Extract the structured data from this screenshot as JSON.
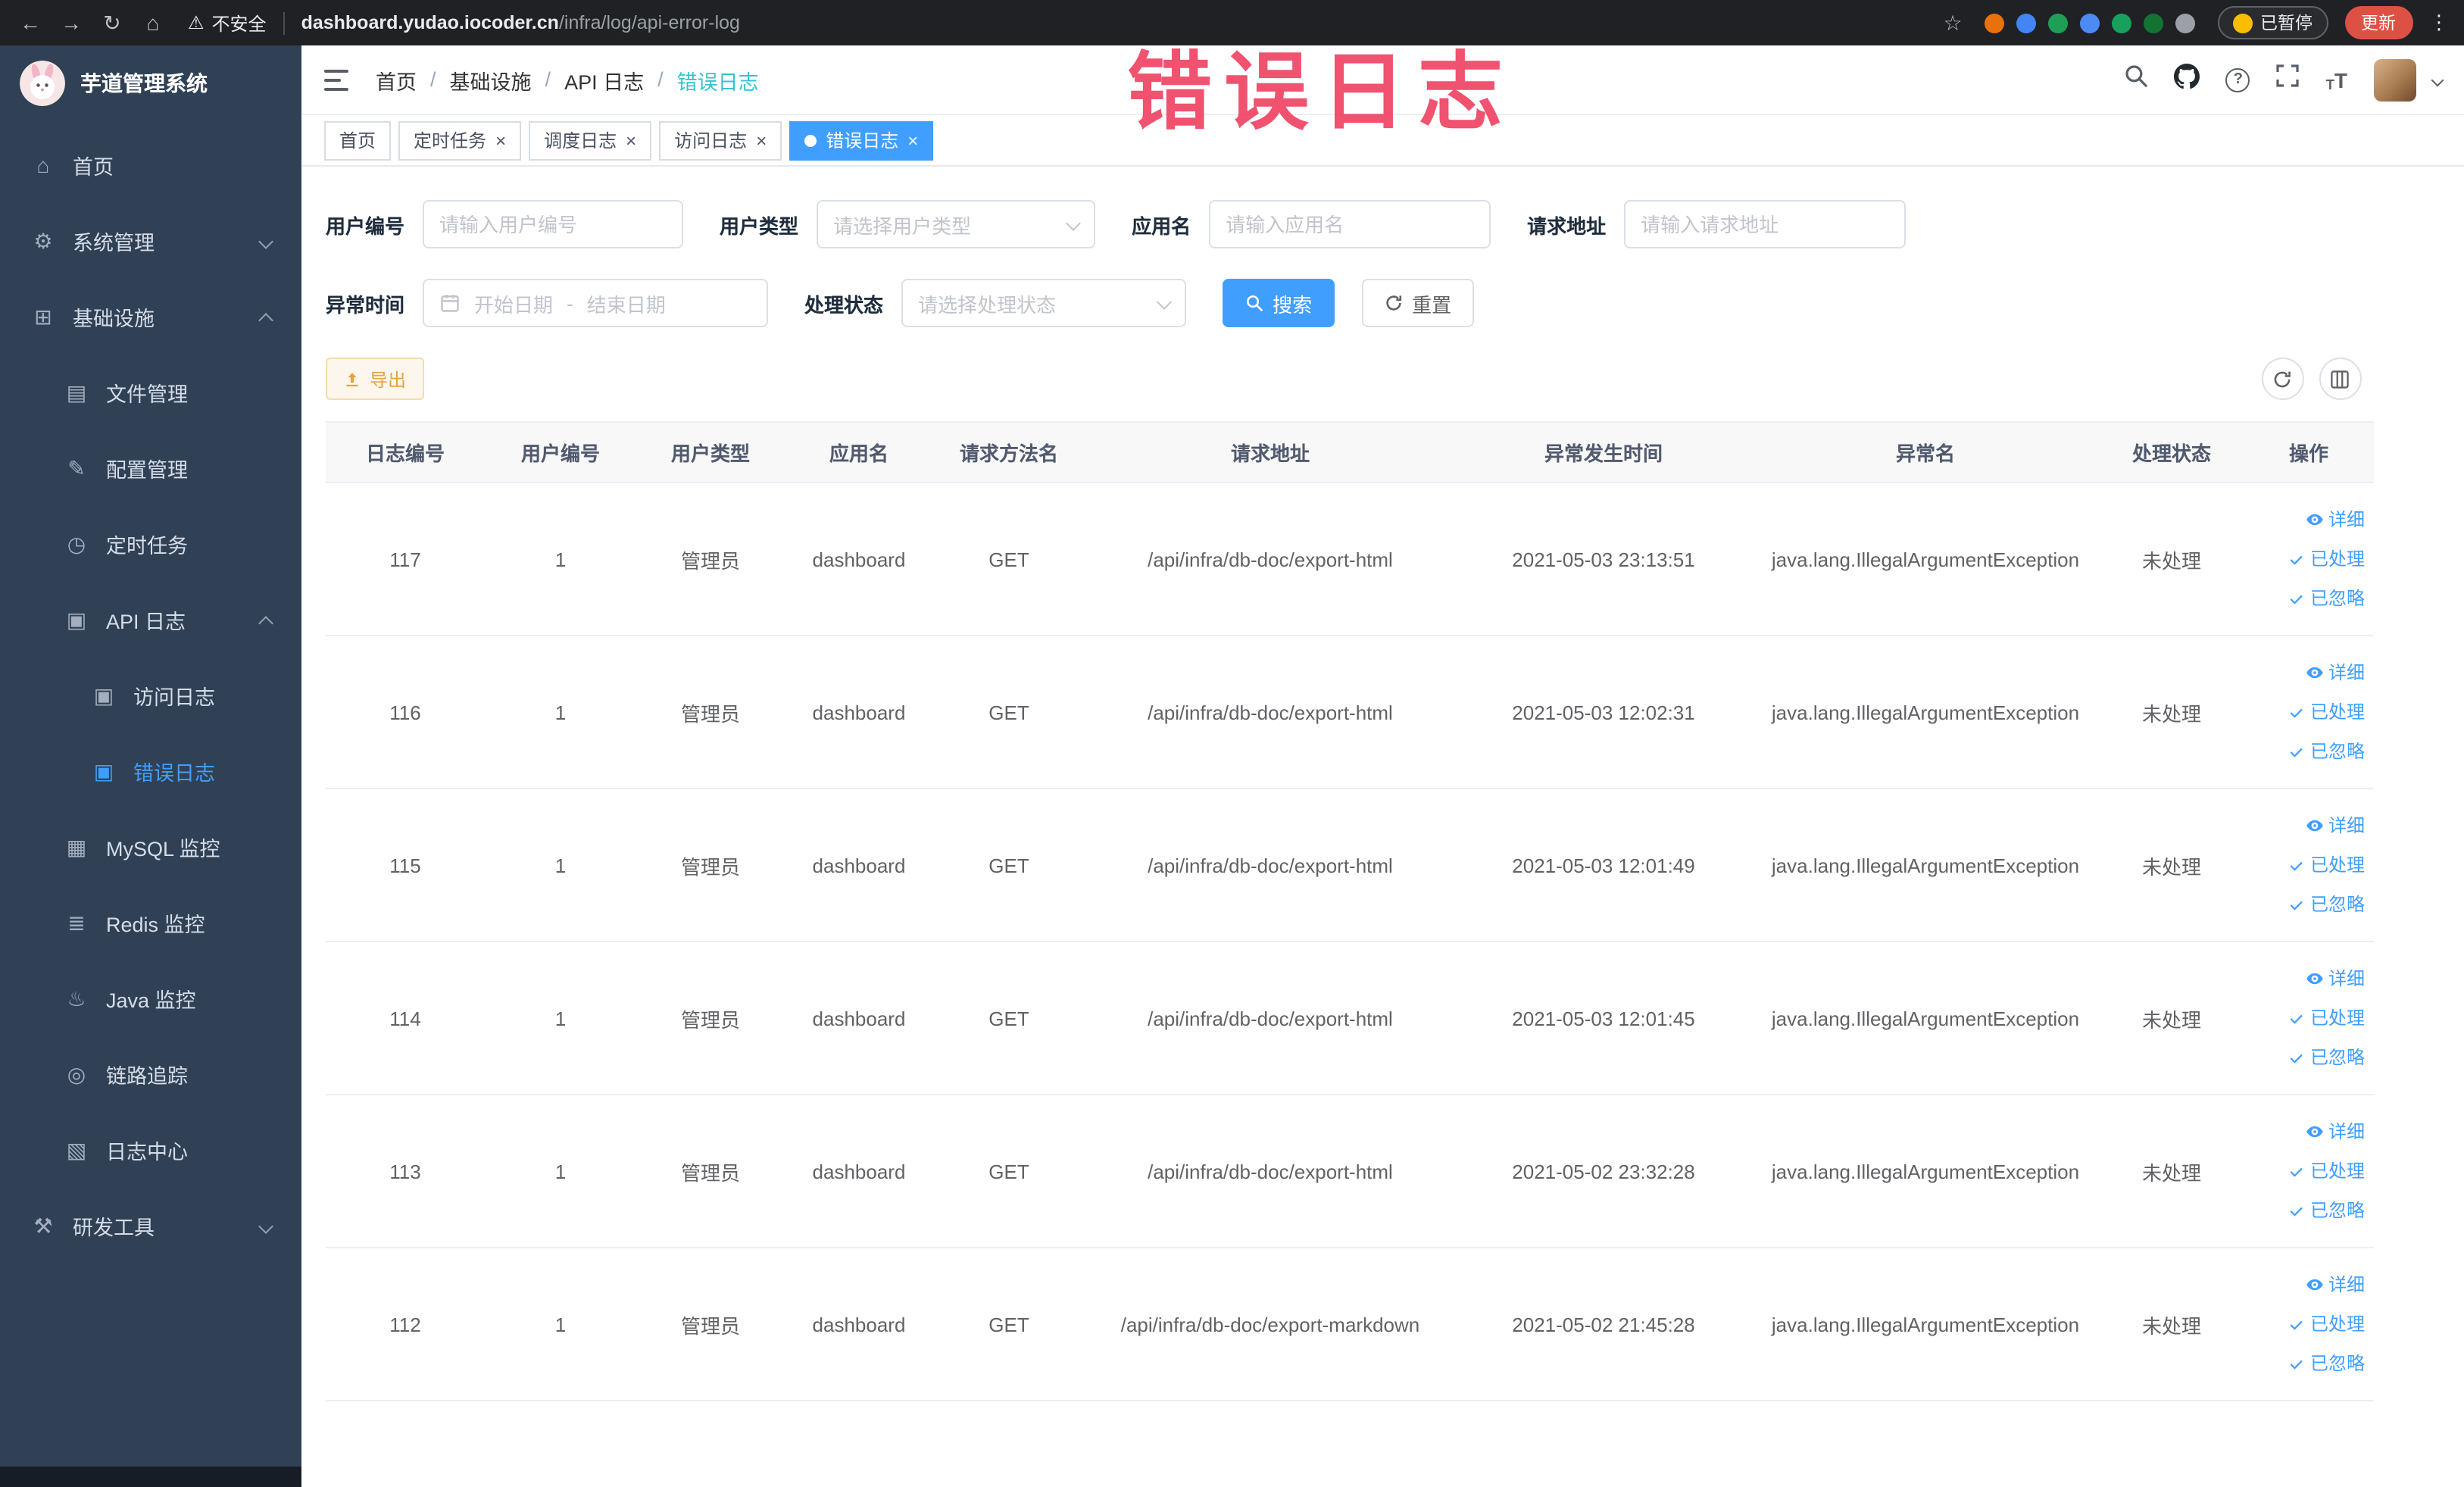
{
  "annotation": {
    "text": "错误日志"
  },
  "colors": {
    "primary": "#409eff",
    "warning": "#e6a23c",
    "annotation": "#ee3b5c",
    "sidebar_bg": "#304156",
    "active_tab_bg": "#409eff"
  },
  "browser": {
    "security_label": "不安全",
    "url_domain": "dashboard.yudao.iocoder.cn",
    "url_path": "/infra/log/api-error-log",
    "paused_badge": "已暂停",
    "update_button": "更新",
    "extension_colors": [
      "#e8710a",
      "#4285f4",
      "#1e9e57",
      "#4c8bf5",
      "#18a05e",
      "#137333",
      "#9aa0a6"
    ]
  },
  "app": {
    "logo_title": "芋道管理系统"
  },
  "sidebar": {
    "items": [
      {
        "name": "home",
        "icon": "home",
        "level": 0,
        "label": "首页"
      },
      {
        "name": "system-manage",
        "icon": "gear",
        "level": 0,
        "label": "系统管理",
        "chevron": "down"
      },
      {
        "name": "infrastructure",
        "icon": "grid",
        "level": 0,
        "label": "基础设施",
        "chevron": "up"
      },
      {
        "name": "file-manage",
        "icon": "file",
        "level": 1,
        "label": "文件管理"
      },
      {
        "name": "config-manage",
        "icon": "edit",
        "level": 1,
        "label": "配置管理"
      },
      {
        "name": "scheduled-job",
        "icon": "clock",
        "level": 1,
        "label": "定时任务"
      },
      {
        "name": "api-log",
        "icon": "doc",
        "level": 1,
        "label": "API 日志",
        "chevron": "up"
      },
      {
        "name": "access-log",
        "icon": "doc",
        "level": 2,
        "label": "访问日志"
      },
      {
        "name": "error-log",
        "icon": "doc",
        "level": 2,
        "label": "错误日志",
        "active": true
      },
      {
        "name": "mysql-monitor",
        "icon": "monitor",
        "level": 1,
        "label": "MySQL 监控"
      },
      {
        "name": "redis-monitor",
        "icon": "db",
        "level": 1,
        "label": "Redis 监控"
      },
      {
        "name": "java-monitor",
        "icon": "java",
        "level": 1,
        "label": "Java 监控"
      },
      {
        "name": "trace",
        "icon": "trace",
        "level": 1,
        "label": "链路追踪"
      },
      {
        "name": "log-center",
        "icon": "log",
        "level": 1,
        "label": "日志中心"
      },
      {
        "name": "dev-tools",
        "icon": "tools",
        "level": 0,
        "label": "研发工具",
        "chevron": "down"
      }
    ]
  },
  "header": {
    "breadcrumbs": [
      "首页",
      "基础设施",
      "API 日志",
      "错误日志"
    ]
  },
  "tabs": [
    {
      "label": "首页",
      "closable": false,
      "active": false
    },
    {
      "label": "定时任务",
      "closable": true,
      "active": false
    },
    {
      "label": "调度日志",
      "closable": true,
      "active": false
    },
    {
      "label": "访问日志",
      "closable": true,
      "active": false
    },
    {
      "label": "错误日志",
      "closable": true,
      "active": true
    }
  ],
  "filters": {
    "user_id": {
      "label": "用户编号",
      "placeholder": "请输入用户编号"
    },
    "user_type": {
      "label": "用户类型",
      "placeholder": "请选择用户类型"
    },
    "app_name": {
      "label": "应用名",
      "placeholder": "请输入应用名"
    },
    "request_url": {
      "label": "请求地址",
      "placeholder": "请输入请求地址"
    },
    "exception_time": {
      "label": "异常时间",
      "start_placeholder": "开始日期",
      "separator": "-",
      "end_placeholder": "结束日期"
    },
    "process_status": {
      "label": "处理状态",
      "placeholder": "请选择处理状态"
    },
    "search_button": "搜索",
    "reset_button": "重置"
  },
  "toolbar": {
    "export_button": "导出"
  },
  "table": {
    "columns": [
      {
        "key": "id",
        "label": "日志编号"
      },
      {
        "key": "user_id",
        "label": "用户编号"
      },
      {
        "key": "user_type",
        "label": "用户类型"
      },
      {
        "key": "app_name",
        "label": "应用名"
      },
      {
        "key": "method",
        "label": "请求方法名"
      },
      {
        "key": "url",
        "label": "请求地址"
      },
      {
        "key": "time",
        "label": "异常发生时间"
      },
      {
        "key": "exception",
        "label": "异常名"
      },
      {
        "key": "status",
        "label": "处理状态"
      },
      {
        "key": "actions",
        "label": "操作"
      }
    ],
    "rows": [
      {
        "id": "117",
        "user_id": "1",
        "user_type": "管理员",
        "app_name": "dashboard",
        "method": "GET",
        "url": "/api/infra/db-doc/export-html",
        "time": "2021-05-03 23:13:51",
        "exception": "java.lang.IllegalArgumentException",
        "status": "未处理"
      },
      {
        "id": "116",
        "user_id": "1",
        "user_type": "管理员",
        "app_name": "dashboard",
        "method": "GET",
        "url": "/api/infra/db-doc/export-html",
        "time": "2021-05-03 12:02:31",
        "exception": "java.lang.IllegalArgumentException",
        "status": "未处理"
      },
      {
        "id": "115",
        "user_id": "1",
        "user_type": "管理员",
        "app_name": "dashboard",
        "method": "GET",
        "url": "/api/infra/db-doc/export-html",
        "time": "2021-05-03 12:01:49",
        "exception": "java.lang.IllegalArgumentException",
        "status": "未处理"
      },
      {
        "id": "114",
        "user_id": "1",
        "user_type": "管理员",
        "app_name": "dashboard",
        "method": "GET",
        "url": "/api/infra/db-doc/export-html",
        "time": "2021-05-03 12:01:45",
        "exception": "java.lang.IllegalArgumentException",
        "status": "未处理"
      },
      {
        "id": "113",
        "user_id": "1",
        "user_type": "管理员",
        "app_name": "dashboard",
        "method": "GET",
        "url": "/api/infra/db-doc/export-html",
        "time": "2021-05-02 23:32:28",
        "exception": "java.lang.IllegalArgumentException",
        "status": "未处理"
      },
      {
        "id": "112",
        "user_id": "1",
        "user_type": "管理员",
        "app_name": "dashboard",
        "method": "GET",
        "url": "/api/infra/db-doc/export-markdown",
        "time": "2021-05-02 21:45:28",
        "exception": "java.lang.IllegalArgumentException",
        "status": "未处理"
      }
    ],
    "row_actions": [
      {
        "name": "detail",
        "icon": "eye",
        "label": "详细"
      },
      {
        "name": "processed",
        "icon": "check",
        "label": "已处理"
      },
      {
        "name": "ignored",
        "icon": "check",
        "label": "已忽略"
      }
    ]
  }
}
